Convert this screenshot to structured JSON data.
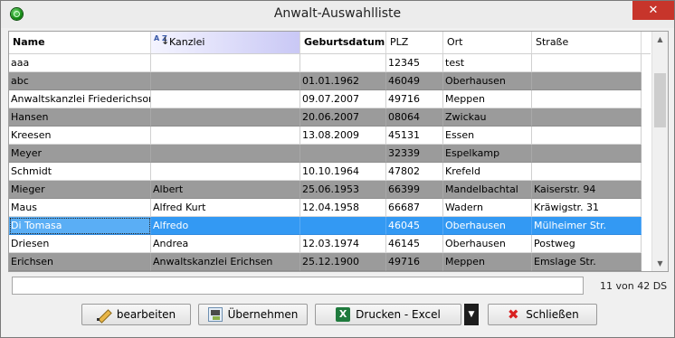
{
  "window": {
    "title": "Anwalt-Auswahlliste",
    "close_glyph": "✕"
  },
  "grid": {
    "columns": [
      "Name",
      "Kanzlei",
      "Geburtsdatum",
      "PLZ",
      "Ort",
      "Straße"
    ],
    "sort_icon": {
      "letters": "A Z"
    },
    "rows": [
      [
        "aaa",
        "",
        "",
        "12345",
        "test",
        ""
      ],
      [
        "abc",
        "",
        "01.01.1962",
        "46049",
        "Oberhausen",
        ""
      ],
      [
        "Anwaltskanzlei Friederichson",
        "",
        "09.07.2007",
        "49716",
        "Meppen",
        ""
      ],
      [
        "Hansen",
        "",
        "20.06.2007",
        "08064",
        "Zwickau",
        ""
      ],
      [
        "Kreesen",
        "",
        "13.08.2009",
        "45131",
        "Essen",
        ""
      ],
      [
        "Meyer",
        "",
        "",
        "32339",
        "Espelkamp",
        ""
      ],
      [
        "Schmidt",
        "",
        "10.10.1964",
        "47802",
        "Krefeld",
        ""
      ],
      [
        "Mieger",
        "Albert",
        "25.06.1953",
        "66399",
        "Mandelbachtal",
        "Kaiserstr. 94"
      ],
      [
        "Maus",
        "Alfred Kurt",
        "12.04.1958",
        "66687",
        "Wadern",
        "Kräwigstr. 31"
      ],
      [
        "Di Tomasa",
        "Alfredo",
        "",
        "46045",
        "Oberhausen",
        "Mülheimer Str."
      ],
      [
        "Driesen",
        "Andrea",
        "12.03.1974",
        "46145",
        "Oberhausen",
        "Postweg"
      ],
      [
        "Erichsen",
        "Anwaltskanzlei Erichsen",
        "25.12.1900",
        "49716",
        "Meppen",
        "Emslage Str."
      ]
    ],
    "selected_row": 9
  },
  "filter": {
    "value": ""
  },
  "status": {
    "count": "11 von 42 DS"
  },
  "buttons": {
    "edit": "bearbeiten",
    "take": "Übernehmen",
    "print": "Drucken - Excel",
    "close": "Schließen"
  },
  "colors": {
    "selected": "#3399f3",
    "alt_row": "#9b9b9b",
    "close_button": "#c7352b"
  }
}
